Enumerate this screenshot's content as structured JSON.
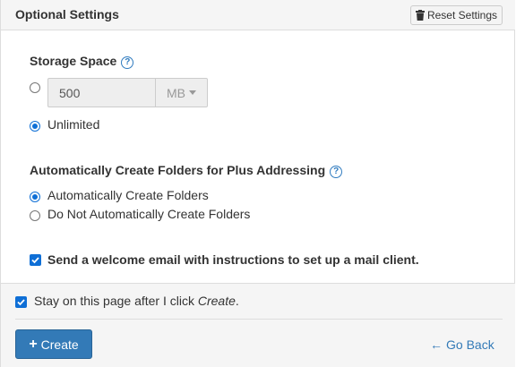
{
  "panel": {
    "title": "Optional Settings",
    "reset_label": "Reset Settings"
  },
  "storage": {
    "label": "Storage Space",
    "value": "500",
    "unit": "MB",
    "unlimited_label": "Unlimited",
    "selected": "unlimited"
  },
  "plus_addressing": {
    "label": "Automatically Create Folders for Plus Addressing",
    "options": [
      {
        "label": "Automatically Create Folders",
        "checked": true
      },
      {
        "label": "Do Not Automatically Create Folders",
        "checked": false
      }
    ]
  },
  "welcome_email": {
    "label": "Send a welcome email with instructions to set up a mail client.",
    "checked": true
  },
  "footer": {
    "stay_label_prefix": "Stay on this page after I click ",
    "stay_label_emphasis": "Create",
    "stay_label_suffix": ".",
    "stay_checked": true,
    "create_label": "Create",
    "go_back_label": "Go Back"
  },
  "colors": {
    "accent": "#337ab7",
    "radio_checked": "#0f6fd6",
    "header_bg": "#f5f5f5"
  }
}
